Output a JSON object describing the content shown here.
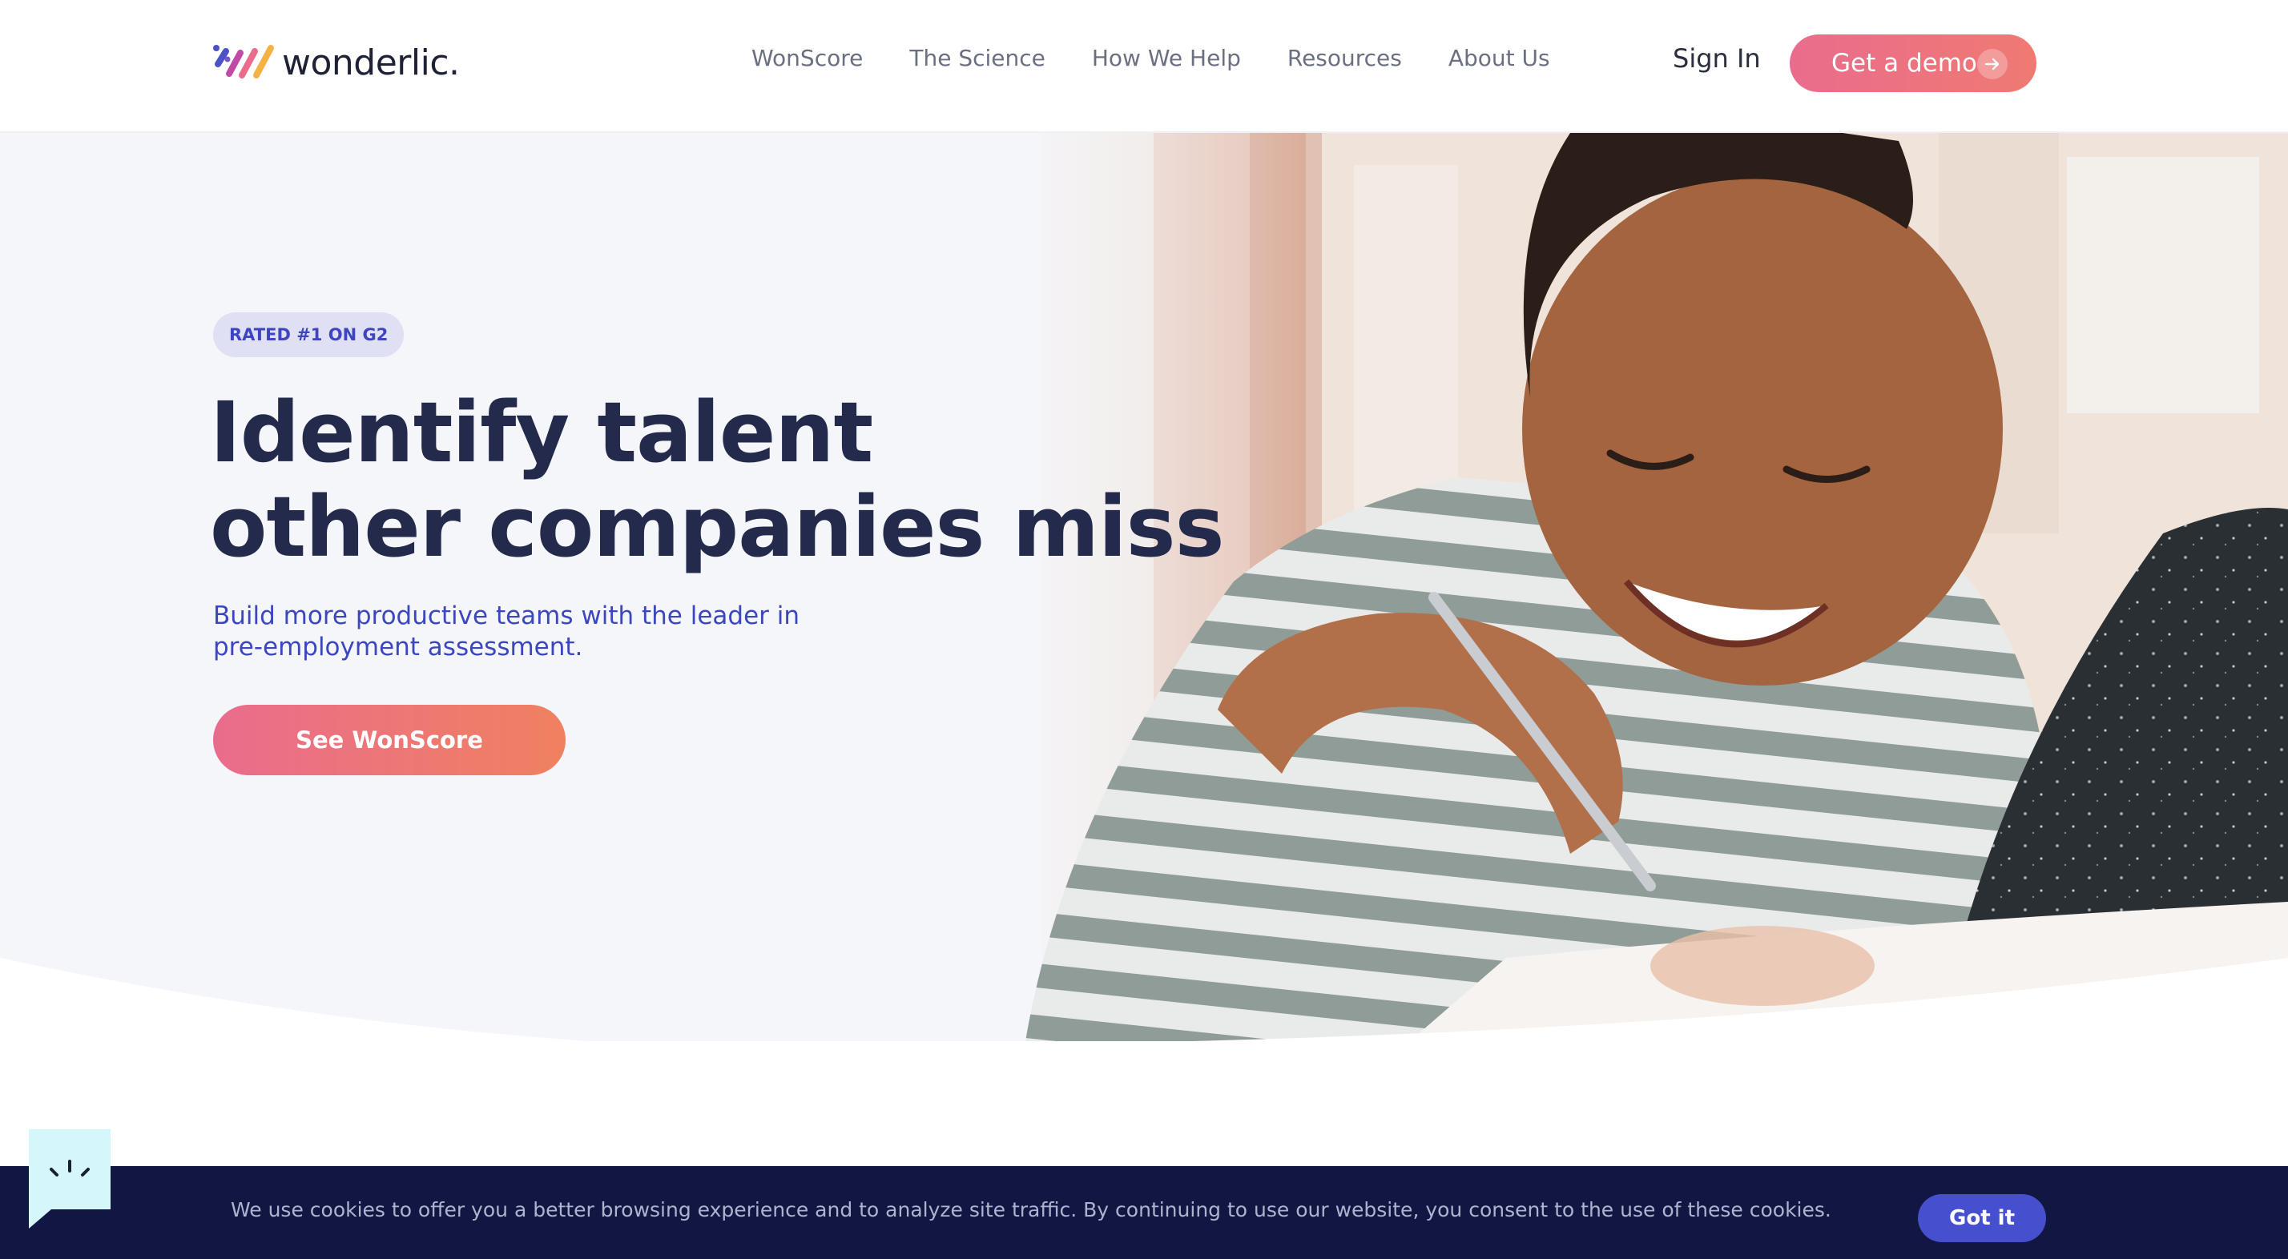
{
  "brand": {
    "name": "wonderlic."
  },
  "nav": [
    {
      "label": "WonScore"
    },
    {
      "label": "The Science"
    },
    {
      "label": "How We Help"
    },
    {
      "label": "Resources"
    },
    {
      "label": "About Us"
    }
  ],
  "header": {
    "sign_in": "Sign In",
    "demo_button": "Get a demo",
    "demo_icon": "arrow-right-icon"
  },
  "hero": {
    "badge": "RATED #1 ON G2",
    "headline_line1": "Identify talent",
    "headline_line2": "other companies miss",
    "sub_line1": "Build more productive teams with the leader in",
    "sub_line2": "pre-employment assessment.",
    "cta": "See WonScore"
  },
  "cookie": {
    "text": "We use cookies to offer you a better browsing experience and to analyze site traffic. By continuing to use our website, you consent to the use of these cookies.",
    "button": "Got it"
  },
  "chat": {
    "icon": "chat-bubble-icon"
  },
  "colors": {
    "accent_gradient_start": "#ea6c8d",
    "accent_gradient_end": "#ef8160",
    "headline": "#232a4b",
    "subtext": "#3c47bd",
    "badge_bg": "#dfe0f3",
    "cookie_bg": "#121642",
    "got_it_bg": "#4650cf",
    "chat_bg": "#d5f6fb"
  }
}
